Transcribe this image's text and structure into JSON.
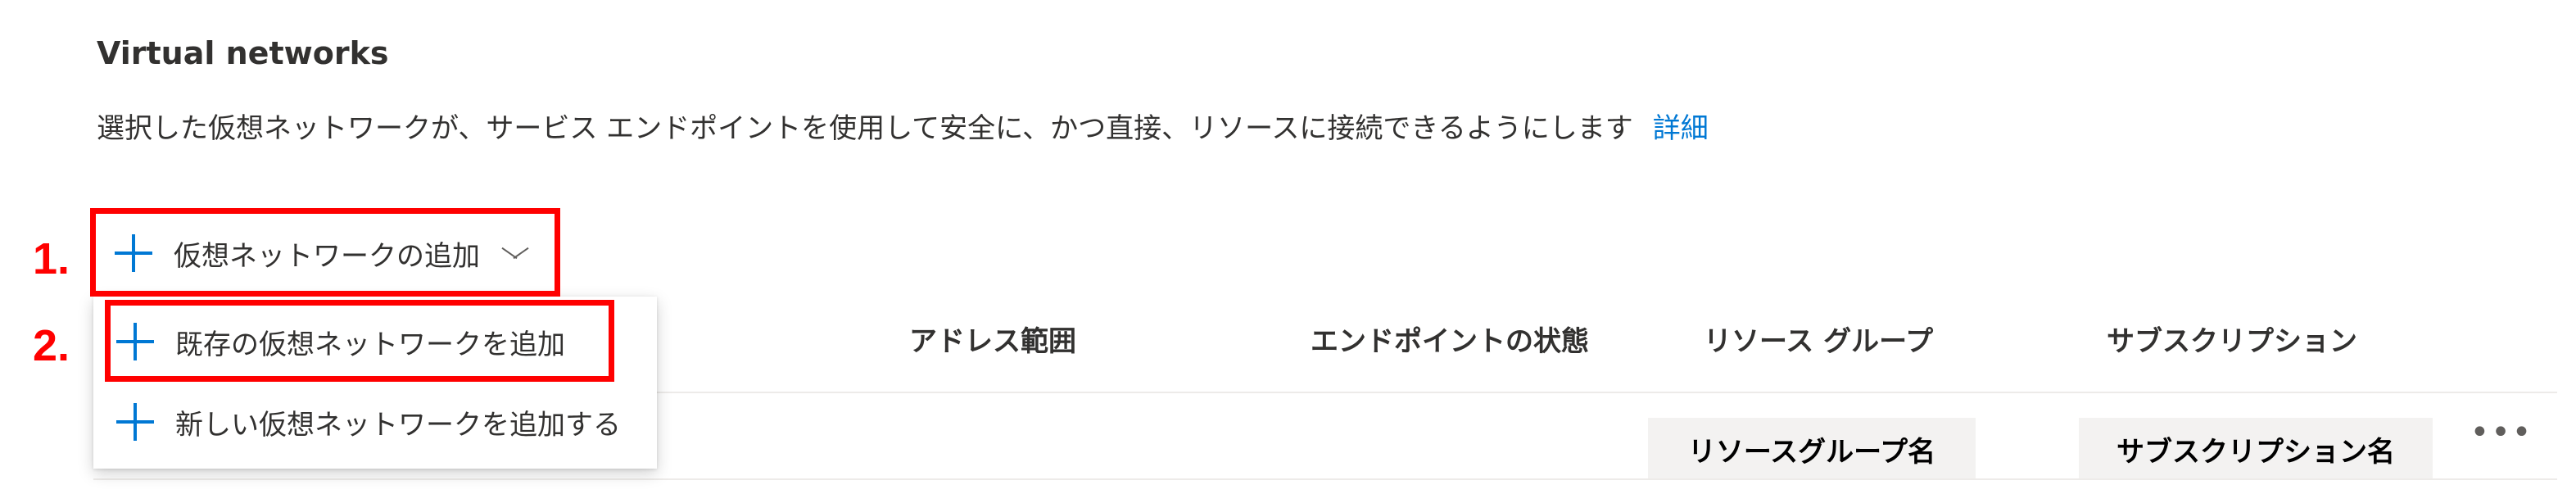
{
  "section": {
    "title": "Virtual networks",
    "description": "選択した仮想ネットワークが、サービス エンドポイントを使用して安全に、かつ直接、リソースに接続できるようにします",
    "learn_more": "詳細"
  },
  "steps": {
    "step1": "1.",
    "step2": "2."
  },
  "toolbar": {
    "add_vnet_label": "仮想ネットワークの追加",
    "add_icon": "plus-icon",
    "dropdown_icon": "chevron-down-icon"
  },
  "menu": {
    "items": [
      {
        "label": "既存の仮想ネットワークを追加",
        "icon": "plus-icon"
      },
      {
        "label": "新しい仮想ネットワークを追加する",
        "icon": "plus-icon"
      }
    ]
  },
  "table": {
    "columns": [
      "アドレス範囲",
      "エンドポイントの状態",
      "リソース グループ",
      "サブスクリプション"
    ],
    "rows": [
      {
        "resource_group": "リソースグループ名",
        "subscription": "サブスクリプション名",
        "more_icon": "more-icon"
      }
    ]
  },
  "colors": {
    "accent": "#0078d4",
    "annotation": "#ff0000",
    "text": "#323130"
  }
}
